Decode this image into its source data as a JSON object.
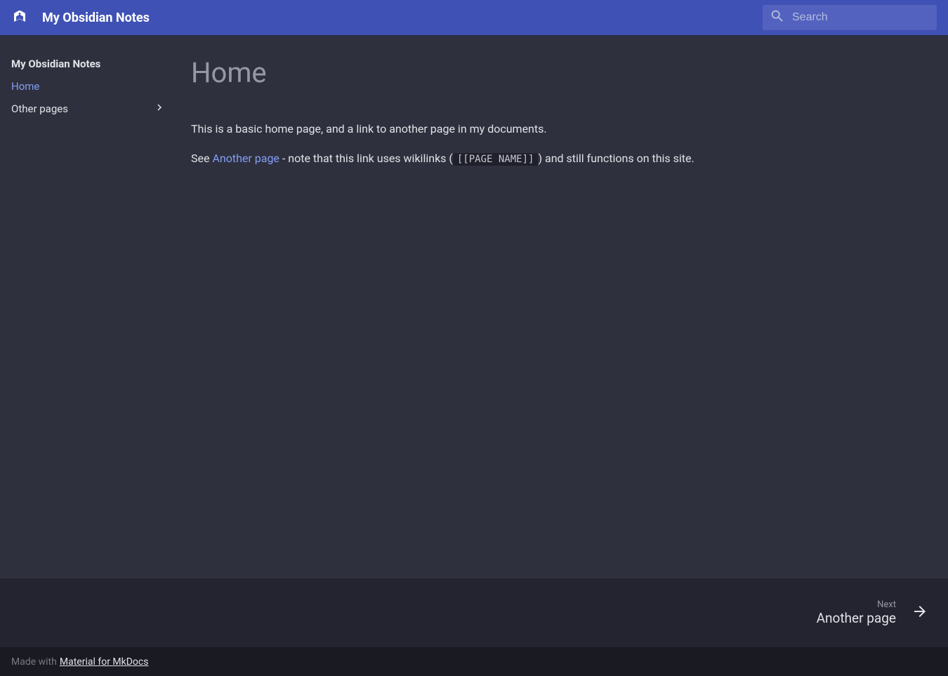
{
  "header": {
    "title": "My Obsidian Notes"
  },
  "search": {
    "placeholder": "Search"
  },
  "sidebar": {
    "title": "My Obsidian Notes",
    "items": [
      {
        "label": "Home",
        "active": true,
        "expandable": false
      },
      {
        "label": "Other pages",
        "active": false,
        "expandable": true
      }
    ]
  },
  "page": {
    "heading": "Home",
    "para1": "This is a basic home page, and a link to another page in my documents.",
    "para2_pre": "See ",
    "para2_link": "Another page",
    "para2_mid": " - note that this link uses wikilinks (",
    "para2_code": "[[PAGE NAME]]",
    "para2_post": ") and still functions on this site."
  },
  "footerNav": {
    "next_label": "Next",
    "next_title": "Another page"
  },
  "footerMeta": {
    "made_with": "Made with",
    "generator": "Material for MkDocs"
  }
}
